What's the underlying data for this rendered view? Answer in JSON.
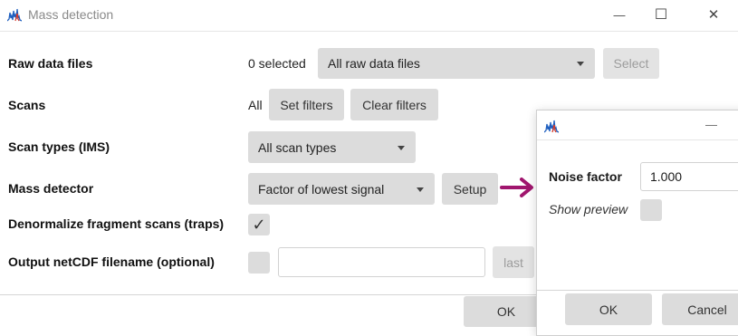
{
  "window": {
    "title": "Mass detection",
    "minimize": "—",
    "maximize": "☐",
    "close": "✕"
  },
  "form": {
    "raw_data_files": {
      "label": "Raw data files",
      "selected_text": "0 selected",
      "combo_value": "All raw data files",
      "select_button": "Select"
    },
    "scans": {
      "label": "Scans",
      "value": "All",
      "set_filters": "Set filters",
      "clear_filters": "Clear filters"
    },
    "scan_types": {
      "label": "Scan types (IMS)",
      "combo_value": "All scan types"
    },
    "mass_detector": {
      "label": "Mass detector",
      "combo_value": "Factor of lowest signal",
      "setup_button": "Setup"
    },
    "denormalize": {
      "label": "Denormalize fragment scans (traps)",
      "checked": true,
      "check_glyph": "✓"
    },
    "output_netcdf": {
      "label": "Output netCDF filename (optional)",
      "checked": false,
      "filename": "",
      "last_button": "last"
    }
  },
  "footer": {
    "ok_label": "OK"
  },
  "popup": {
    "minimize": "—",
    "noise_factor_label": "Noise factor",
    "noise_factor_value": "1.000",
    "show_preview_label": "Show preview",
    "show_preview_checked": false,
    "ok_label": "OK",
    "cancel_label": "Cancel"
  },
  "colors": {
    "accent_arrow": "#a0166e",
    "icon_blue": "#1f5fbf",
    "icon_red": "#d63a2a"
  }
}
